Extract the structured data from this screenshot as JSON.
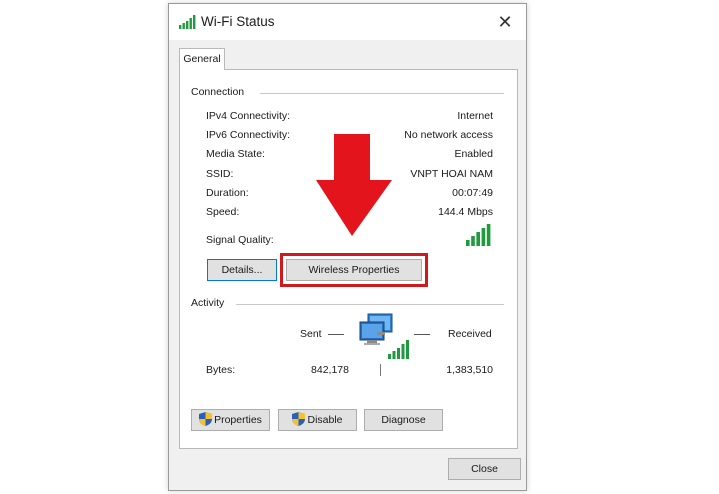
{
  "window": {
    "title": "Wi-Fi Status",
    "close_glyph": "✕"
  },
  "tabs": [
    {
      "label": "General"
    }
  ],
  "connection": {
    "heading": "Connection",
    "rows": [
      {
        "label": "IPv4 Connectivity:",
        "value": "Internet"
      },
      {
        "label": "IPv6 Connectivity:",
        "value": "No network access"
      },
      {
        "label": "Media State:",
        "value": "Enabled"
      },
      {
        "label": "SSID:",
        "value": "VNPT HOAI NAM"
      },
      {
        "label": "Duration:",
        "value": "00:07:49"
      },
      {
        "label": "Speed:",
        "value": "144.4 Mbps"
      }
    ],
    "signal_label": "Signal Quality:",
    "signal_bars": 5,
    "details_label": "Details...",
    "wireless_properties_label": "Wireless Properties"
  },
  "activity": {
    "heading": "Activity",
    "sent_label": "Sent",
    "received_label": "Received",
    "bytes_label": "Bytes:",
    "bytes_sent": "842,178",
    "bytes_received": "1,383,510",
    "properties_label": "Properties",
    "disable_label": "Disable",
    "diagnose_label": "Diagnose"
  },
  "footer": {
    "close_label": "Close"
  },
  "annotation": {
    "arrow_color": "#e3141c",
    "highlight_color": "#d0181f"
  },
  "icons": {
    "title": "wifi-signal-icon",
    "signal": "signal-bars-icon",
    "network": "network-computers-icon",
    "shield": "uac-shield-icon",
    "arrow": "down-arrow-icon"
  }
}
